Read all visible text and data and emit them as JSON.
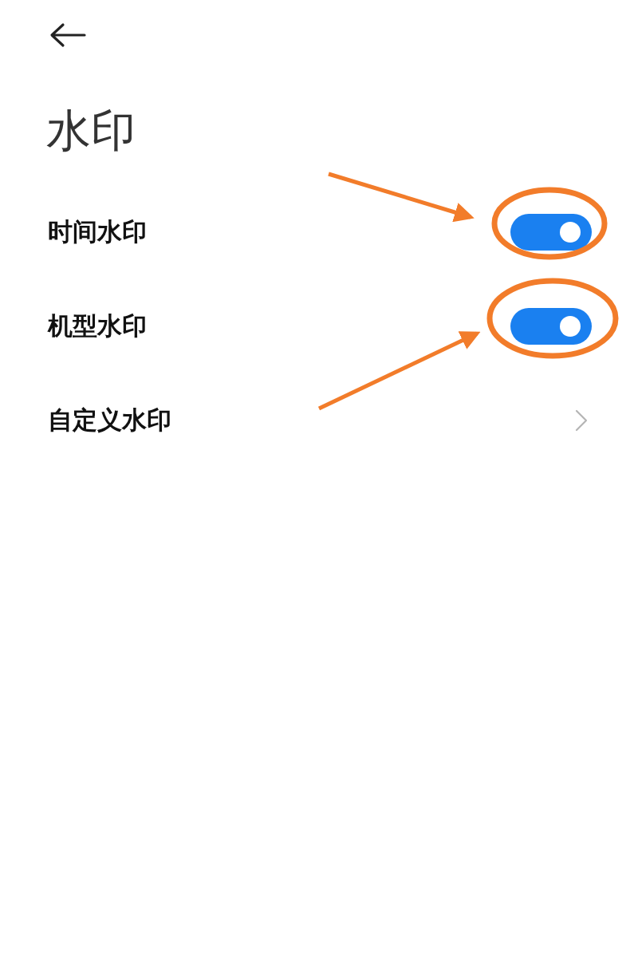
{
  "title": "水印",
  "items": [
    {
      "kind": "toggle",
      "label": "时间水印",
      "on": true
    },
    {
      "kind": "toggle",
      "label": "机型水印",
      "on": true
    },
    {
      "kind": "link",
      "label": "自定义水印"
    }
  ]
}
